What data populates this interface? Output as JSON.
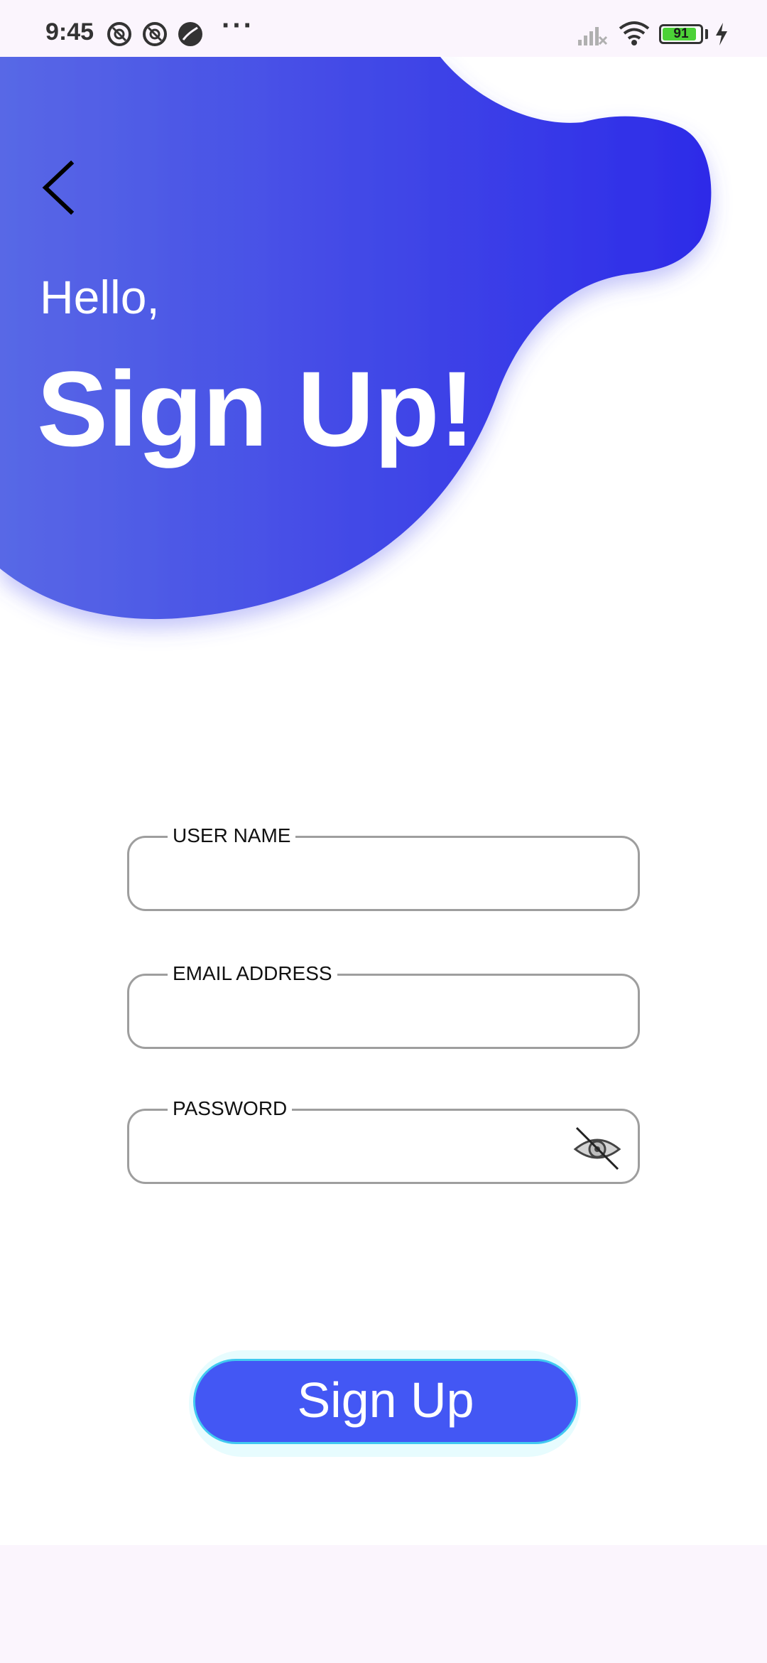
{
  "status_bar": {
    "time": "9:45",
    "dots": "···",
    "battery_level": "91",
    "battery_fraction": 0.91,
    "icons": [
      "notification-icon",
      "notification-icon",
      "app-icon",
      "signal-icon",
      "wifi-icon",
      "battery-icon",
      "charging-icon"
    ]
  },
  "header": {
    "greeting": "Hello,",
    "title": "Sign Up!",
    "back_icon": "chevron-left-icon"
  },
  "form": {
    "username": {
      "label": "USER NAME",
      "value": ""
    },
    "email": {
      "label": "EMAIL ADDRESS",
      "value": ""
    },
    "password": {
      "label": "PASSWORD",
      "value": "",
      "toggle_icon": "eye-off-icon"
    }
  },
  "actions": {
    "signup_label": "Sign Up"
  },
  "colors": {
    "gradient_start": "#5868e6",
    "gradient_end": "#2d2be8",
    "button": "#4357f4",
    "button_border": "#41c9f0",
    "field_border": "#9e9e9e",
    "status_bar": "#fbf5fd"
  }
}
